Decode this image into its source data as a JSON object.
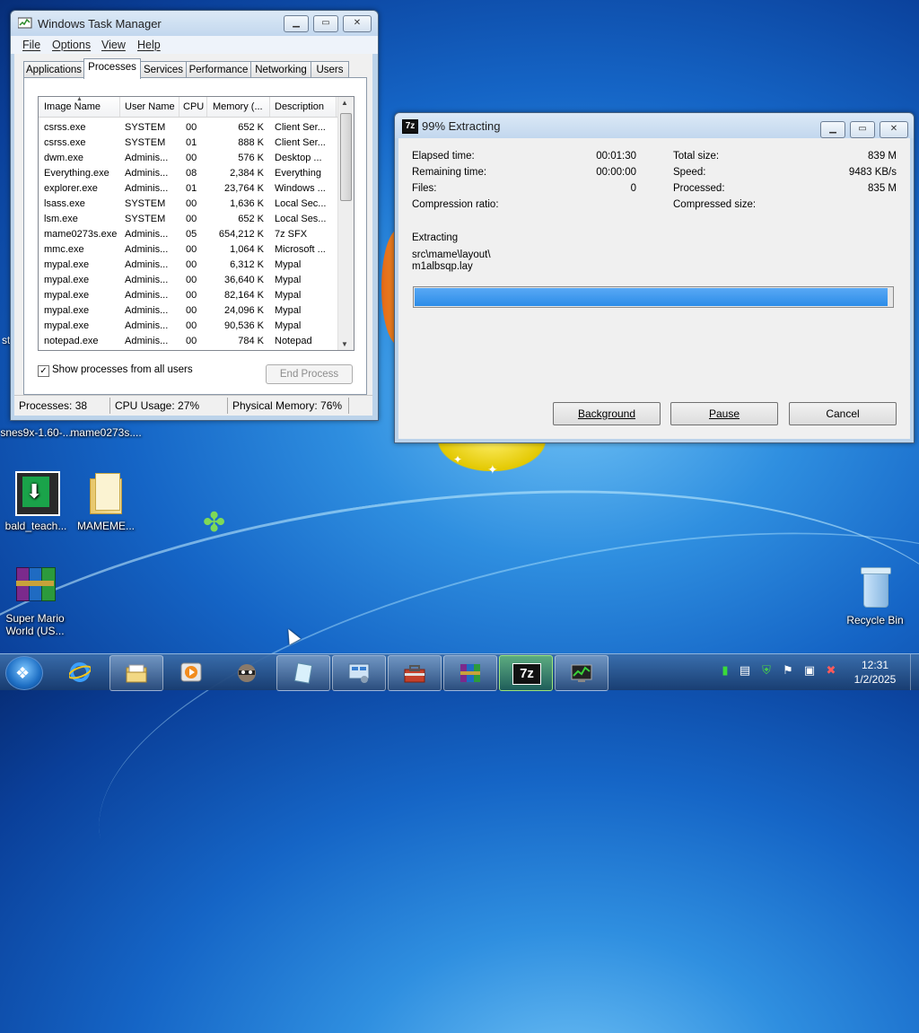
{
  "taskmgr": {
    "title": "Windows Task Manager",
    "menu": [
      "File",
      "Options",
      "View",
      "Help"
    ],
    "tabs": [
      "Applications",
      "Processes",
      "Services",
      "Performance",
      "Networking",
      "Users"
    ],
    "active_tab": "Processes",
    "columns": [
      "Image Name",
      "User Name",
      "CPU",
      "Memory (...",
      "Description"
    ],
    "rows": [
      [
        "csrss.exe",
        "SYSTEM",
        "00",
        "652 K",
        "Client Ser..."
      ],
      [
        "csrss.exe",
        "SYSTEM",
        "01",
        "888 K",
        "Client Ser..."
      ],
      [
        "dwm.exe",
        "Adminis...",
        "00",
        "576 K",
        "Desktop ..."
      ],
      [
        "Everything.exe",
        "Adminis...",
        "08",
        "2,384 K",
        "Everything"
      ],
      [
        "explorer.exe",
        "Adminis...",
        "01",
        "23,764 K",
        "Windows ..."
      ],
      [
        "lsass.exe",
        "SYSTEM",
        "00",
        "1,636 K",
        "Local Sec..."
      ],
      [
        "lsm.exe",
        "SYSTEM",
        "00",
        "652 K",
        "Local Ses..."
      ],
      [
        "mame0273s.exe",
        "Adminis...",
        "05",
        "654,212 K",
        "7z SFX"
      ],
      [
        "mmc.exe",
        "Adminis...",
        "00",
        "1,064 K",
        "Microsoft ..."
      ],
      [
        "mypal.exe",
        "Adminis...",
        "00",
        "6,312 K",
        "Mypal"
      ],
      [
        "mypal.exe",
        "Adminis...",
        "00",
        "36,640 K",
        "Mypal"
      ],
      [
        "mypal.exe",
        "Adminis...",
        "00",
        "82,164 K",
        "Mypal"
      ],
      [
        "mypal.exe",
        "Adminis...",
        "00",
        "24,096 K",
        "Mypal"
      ],
      [
        "mypal.exe",
        "Adminis...",
        "00",
        "90,536 K",
        "Mypal"
      ],
      [
        "notepad.exe",
        "Adminis...",
        "00",
        "784 K",
        "Notepad"
      ]
    ],
    "show_all_label": "Show processes from all users",
    "show_all_checked": "✓",
    "end_process": "End Process",
    "status": {
      "processes": "Processes: 38",
      "cpu": "CPU Usage: 27%",
      "memory": "Physical Memory: 76%"
    }
  },
  "zip": {
    "title": "99% Extracting",
    "icon_text": "7z",
    "left_stats": [
      {
        "label": "Elapsed time:",
        "value": "00:01:30"
      },
      {
        "label": "Remaining time:",
        "value": "00:00:00"
      },
      {
        "label": "Files:",
        "value": "0"
      },
      {
        "label": "Compression ratio:",
        "value": ""
      }
    ],
    "right_stats": [
      {
        "label": "Total size:",
        "value": "839 M"
      },
      {
        "label": "Speed:",
        "value": "9483 KB/s"
      },
      {
        "label": "Processed:",
        "value": "835 M"
      },
      {
        "label": "Compressed size:",
        "value": ""
      }
    ],
    "action": "Extracting",
    "path_line1": "src\\mame\\layout\\",
    "path_line2": "m1albsqp.lay",
    "progress": 0.99,
    "buttons": {
      "background": "Background",
      "pause": "Pause",
      "cancel": "Cancel"
    }
  },
  "desktop": {
    "edge_text": "st",
    "icons": [
      {
        "label": "snes9x-1.60-..."
      },
      {
        "label": "mame0273s...."
      },
      {
        "label": "bald_teach..."
      },
      {
        "label": "MAMEME..."
      },
      {
        "label": "Super Mario World (US..."
      },
      {
        "label": "Recycle Bin"
      }
    ]
  },
  "taskbar": {
    "clock_time": "12:31",
    "clock_date": "1/2/2025",
    "zip_button_label": "7z"
  }
}
